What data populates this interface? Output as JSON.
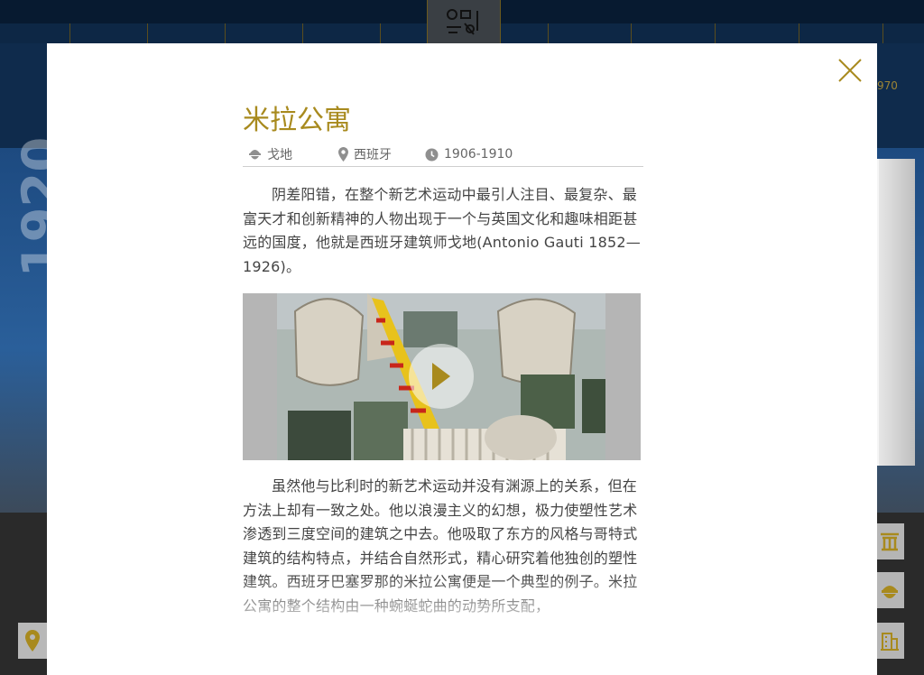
{
  "background": {
    "right_year_label": "970",
    "big_year_label": "1920"
  },
  "modal": {
    "title": "米拉公寓",
    "author": "戈地",
    "country": "西班牙",
    "period": "1906-1910",
    "paragraph1": "阴差阳错，在整个新艺术运动中最引人注目、最复杂、最富天才和创新精神的人物出现于一个与英国文化和趣味相距甚远的国度，他就是西班牙建筑师戈地(Antonio Gauti 1852—1926)。",
    "paragraph2": "虽然他与比利时的新艺术运动并没有渊源上的关系，但在方法上却有一致之处。他以浪漫主义的幻想，极力使塑性艺术渗透到三度空间的建筑之中去。他吸取了东方的风格与哥特式建筑的结构特点，并结合自然形式，精心研究着他独创的塑性建筑。西班牙巴塞罗那的米拉公寓便是一个典型的例子。米拉公寓的整个结构由一种蜿蜒蛇曲的动势所支配，",
    "video_thumbnail": "casa-batllo-facade-with-catalan-flag"
  },
  "colors": {
    "accent_gold": "#a88a1e",
    "navy": "#0c2340",
    "text": "#444444"
  },
  "icons": {
    "close": "close-icon",
    "author": "architect-icon",
    "location": "map-pin-icon",
    "clock": "clock-icon",
    "play": "play-icon"
  }
}
